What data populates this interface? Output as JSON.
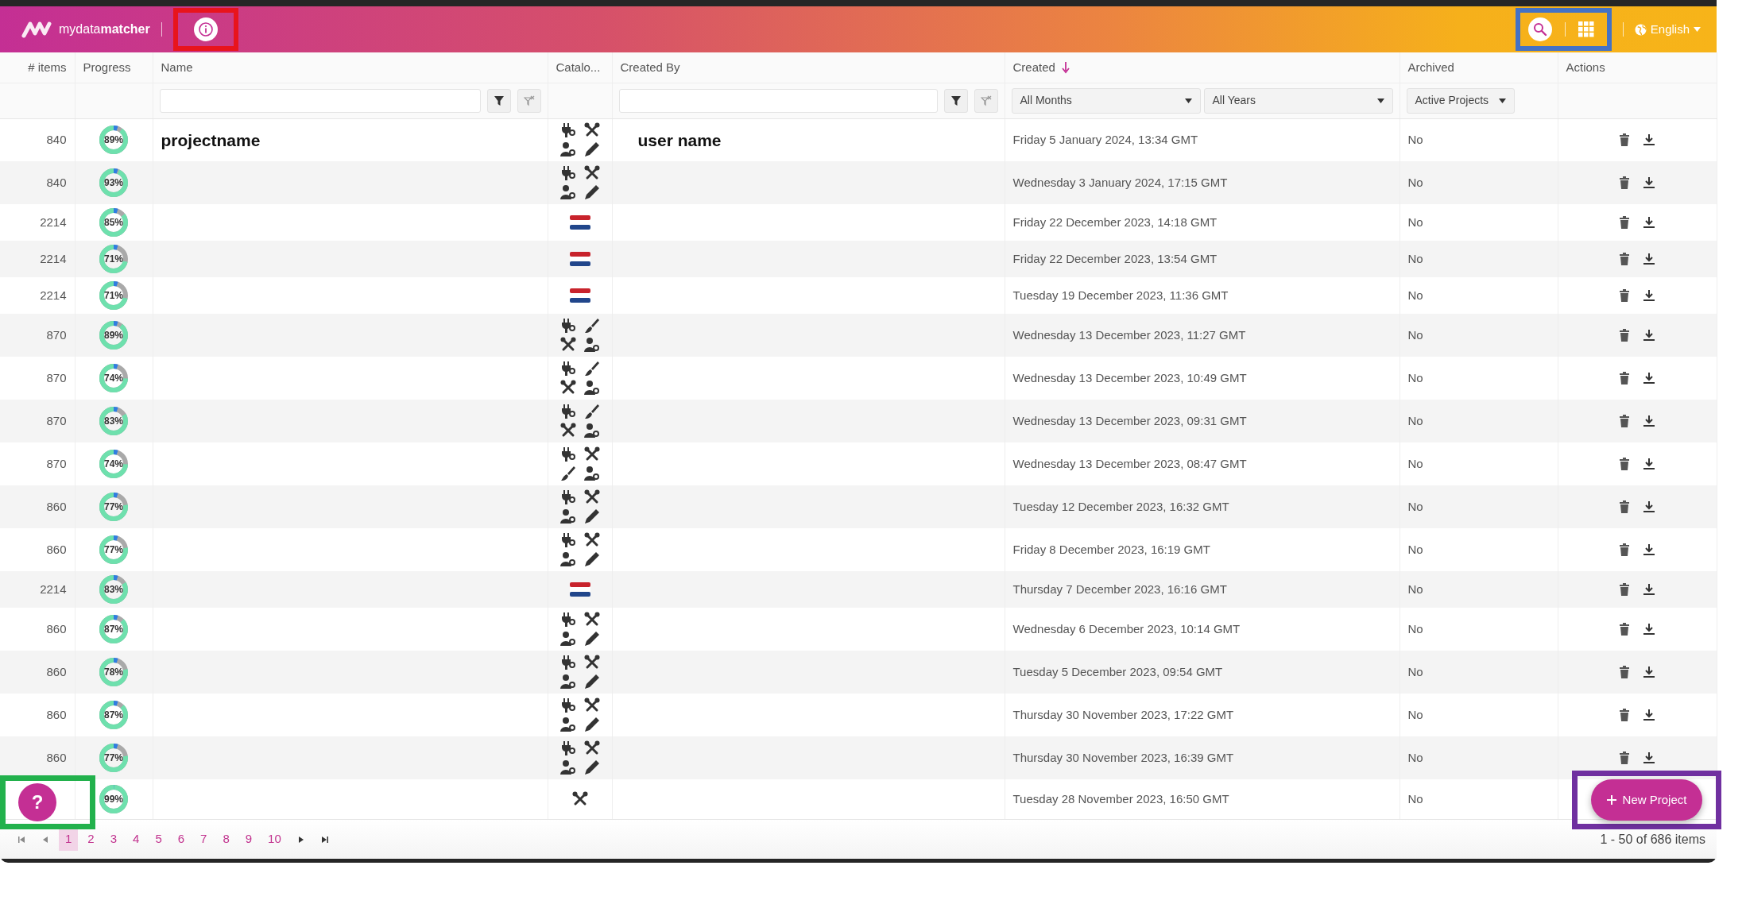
{
  "header": {
    "logo_text": "mydata**matcher**",
    "info_button": {
      "color": "#e8141c"
    },
    "tools": {
      "color": "#4472c4"
    },
    "language": "English"
  },
  "table": {
    "columns": [
      {
        "label": "# items"
      },
      {
        "label": "Progress"
      },
      {
        "label": "Name",
        "filter": {
          "kind": "text"
        }
      },
      {
        "label": "Catalo..."
      },
      {
        "label": "Created By",
        "filter": {
          "kind": "text"
        }
      },
      {
        "label": "Created",
        "sorted_descending": true,
        "filter": {
          "kind": "selects",
          "options": [
            "All Months",
            "All Years"
          ]
        }
      },
      {
        "label": "Archived",
        "filter": {
          "kind": "selects",
          "options": [
            "Active Projects"
          ]
        }
      },
      {
        "label": "Actions"
      }
    ],
    "rows": [
      {
        "items": "840",
        "progress": "89%",
        "level": 0.89,
        "name": "projectname",
        "catalog": {
          "kind": "set_a"
        },
        "created_by": "user name",
        "created": "Friday 5 January 2024, 13:34 GMT",
        "archived": "No",
        "actions": true
      },
      {
        "items": "840",
        "progress": "93%",
        "level": 0.93,
        "catalog": {
          "kind": "set_a"
        },
        "created": "Wednesday 3 January 2024, 17:15 GMT",
        "archived": "No",
        "actions": true
      },
      {
        "items": "2214",
        "progress": "85%",
        "level": 0.85,
        "catalog": {
          "kind": "flag"
        },
        "created": "Friday 22 December 2023, 14:18 GMT",
        "archived": "No",
        "actions": true
      },
      {
        "items": "2214",
        "progress": "71%",
        "level": 0.71,
        "catalog": {
          "kind": "flag"
        },
        "created": "Friday 22 December 2023, 13:54 GMT",
        "archived": "No",
        "actions": true
      },
      {
        "items": "2214",
        "progress": "71%",
        "level": 0.71,
        "catalog": {
          "kind": "flag"
        },
        "created": "Tuesday 19 December 2023, 11:36 GMT",
        "archived": "No",
        "actions": true
      },
      {
        "items": "870",
        "progress": "89%",
        "level": 0.89,
        "catalog": {
          "kind": "set_b"
        },
        "created": "Wednesday 13 December 2023, 11:27 GMT",
        "archived": "No",
        "actions": true
      },
      {
        "items": "870",
        "progress": "74%",
        "level": 0.74,
        "catalog": {
          "kind": "set_b"
        },
        "created": "Wednesday 13 December 2023, 10:49 GMT",
        "archived": "No",
        "actions": true
      },
      {
        "items": "870",
        "progress": "83%",
        "level": 0.83,
        "catalog": {
          "kind": "set_b"
        },
        "created": "Wednesday 13 December 2023, 09:31 GMT",
        "archived": "No",
        "actions": true
      },
      {
        "items": "870",
        "progress": "74%",
        "level": 0.74,
        "catalog": {
          "kind": "set_c"
        },
        "created": "Wednesday 13 December 2023, 08:47 GMT",
        "archived": "No",
        "actions": true
      },
      {
        "items": "860",
        "progress": "77%",
        "level": 0.77,
        "catalog": {
          "kind": "set_a"
        },
        "created": "Tuesday 12 December 2023, 16:32 GMT",
        "archived": "No",
        "actions": true
      },
      {
        "items": "860",
        "progress": "77%",
        "level": 0.77,
        "catalog": {
          "kind": "set_a"
        },
        "created": "Friday 8 December 2023, 16:19 GMT",
        "archived": "No",
        "actions": true
      },
      {
        "items": "2214",
        "progress": "83%",
        "level": 0.83,
        "catalog": {
          "kind": "flag"
        },
        "created": "Thursday 7 December 2023, 16:16 GMT",
        "archived": "No",
        "actions": true
      },
      {
        "items": "860",
        "progress": "87%",
        "level": 0.87,
        "catalog": {
          "kind": "set_a"
        },
        "created": "Wednesday 6 December 2023, 10:14 GMT",
        "archived": "No",
        "actions": true
      },
      {
        "items": "860",
        "progress": "78%",
        "level": 0.78,
        "catalog": {
          "kind": "set_a"
        },
        "created": "Tuesday 5 December 2023, 09:54 GMT",
        "archived": "No",
        "actions": true
      },
      {
        "items": "860",
        "progress": "87%",
        "level": 0.87,
        "catalog": {
          "kind": "set_a"
        },
        "created": "Thursday 30 November 2023, 17:22 GMT",
        "archived": "No",
        "actions": true
      },
      {
        "items": "860",
        "progress": "77%",
        "level": 0.77,
        "catalog": {
          "kind": "set_a"
        },
        "created": "Thursday 30 November 2023, 16:39 GMT",
        "archived": "No",
        "actions": true
      },
      {
        "progress": "99%",
        "level": 0.99,
        "catalog": {
          "kind": "single"
        },
        "created": "Tuesday 28 November 2023, 16:50 GMT",
        "archived": "No",
        "actions": false
      }
    ]
  },
  "pagination": {
    "pages": [
      {
        "label": "1",
        "selected": true
      },
      {
        "label": "2",
        "selected": false
      },
      {
        "label": "3",
        "selected": false
      },
      {
        "label": "4",
        "selected": false
      },
      {
        "label": "5",
        "selected": false
      },
      {
        "label": "6",
        "selected": false
      },
      {
        "label": "7",
        "selected": false
      },
      {
        "label": "8",
        "selected": false
      },
      {
        "label": "9",
        "selected": false
      },
      {
        "label": "10",
        "selected": false
      }
    ],
    "summary": "1 - 50 of 686 items"
  },
  "help_button": {
    "label": "?",
    "color": "#22b14c"
  },
  "new_project_button": {
    "label": "New Project",
    "color": "#7030a0"
  }
}
